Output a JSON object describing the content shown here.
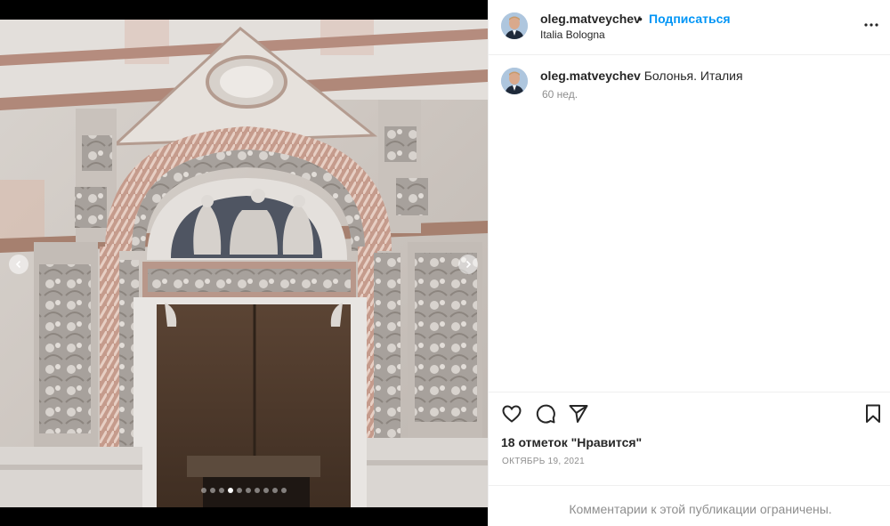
{
  "post": {
    "username": "oleg.matveychev",
    "separator": "•",
    "follow_label": "Подписаться",
    "location": "Italia Bologna"
  },
  "caption": {
    "username": "oleg.matveychev",
    "text": "Болонья. Италия",
    "time": "60 нед."
  },
  "stats": {
    "likes": "18 отметок \"Нравится\"",
    "date": "ОКТЯБРЬ 19, 2021"
  },
  "footer": {
    "comments_limited": "Комментарии к этой публикации ограничены."
  },
  "carousel": {
    "slide_count": 10,
    "active_index": 3
  },
  "icons": {
    "more": "more-options-icon",
    "like": "heart-icon",
    "comment": "comment-icon",
    "share": "send-icon",
    "save": "bookmark-icon",
    "prev": "chevron-left-icon",
    "next": "chevron-right-icon"
  },
  "colors": {
    "accent": "#0095f6",
    "text": "#262626",
    "secondary": "#8e8e8e",
    "border": "#efefef"
  }
}
